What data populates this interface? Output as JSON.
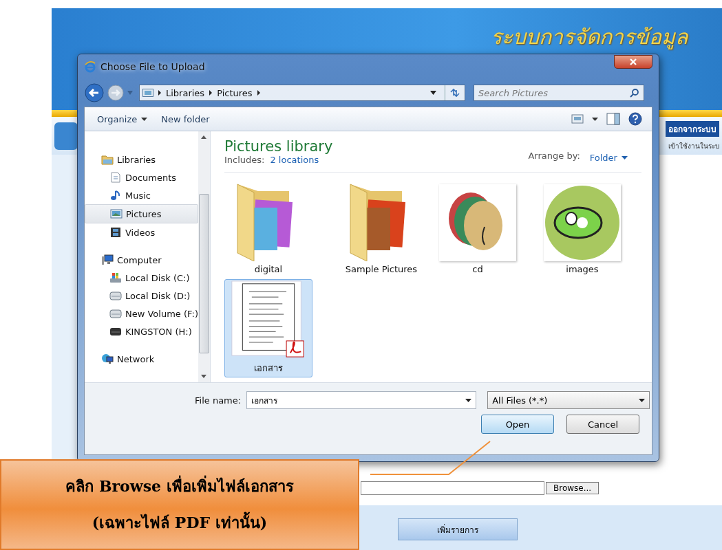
{
  "banner": {
    "title": "ระบบการจัดการข้อมูล",
    "logout": "ออกจากระบบ",
    "user_note": "เข้าใช้งานในระบ"
  },
  "dialog": {
    "title": "Choose File to Upload",
    "breadcrumb": [
      "Libraries",
      "Pictures"
    ],
    "search": {
      "placeholder": "Search Pictures"
    },
    "toolbar": [
      {
        "label": "Organize",
        "menu": true
      },
      {
        "label": "New folder",
        "menu": false
      }
    ],
    "nav": [
      {
        "label": "Libraries",
        "kind": "library",
        "selected": false,
        "children": [
          {
            "label": "Documents",
            "kind": "documents",
            "selected": false
          },
          {
            "label": "Music",
            "kind": "music",
            "selected": false
          },
          {
            "label": "Pictures",
            "kind": "pictures",
            "selected": true
          },
          {
            "label": "Videos",
            "kind": "videos",
            "selected": false
          }
        ]
      },
      {
        "label": "Computer",
        "kind": "computer",
        "selected": false,
        "children": [
          {
            "label": "Local Disk (C:)",
            "kind": "system-drive",
            "selected": false
          },
          {
            "label": "Local Disk (D:)",
            "kind": "drive",
            "selected": false
          },
          {
            "label": "New Volume (F:)",
            "kind": "drive",
            "selected": false
          },
          {
            "label": "KINGSTON (H:)",
            "kind": "usb-drive",
            "selected": false
          }
        ]
      },
      {
        "label": "Network",
        "kind": "network",
        "selected": false
      }
    ],
    "library": {
      "title": "Pictures library",
      "includes_label": "Includes:",
      "includes_link": "2 locations",
      "arrange_label": "Arrange by:",
      "arrange_value": "Folder"
    },
    "items": [
      {
        "name": "digital",
        "kind": "folder",
        "selected": false
      },
      {
        "name": "Sample Pictures",
        "kind": "folder",
        "selected": false
      },
      {
        "name": "cd",
        "selected": false
      },
      {
        "name": "images",
        "selected": false
      },
      {
        "name": "เอกสาร",
        "kind": "document",
        "selected": true
      }
    ],
    "file_name": {
      "label": "File name:",
      "value": "เอกสาร"
    },
    "file_type": "All Files (*.*)",
    "buttons": [
      {
        "label": "Open",
        "kind": "primary"
      },
      {
        "label": "Cancel",
        "kind": "normal"
      }
    ]
  },
  "upload": {
    "browse": "Browse...",
    "add_button": "เพิ่มรายการ"
  },
  "callout": {
    "lines": [
      "คลิก Browse เพื่อเพิ่มไฟล์เอกสาร",
      "(เฉพาะไฟล์ PDF เท่านั้น)"
    ]
  }
}
